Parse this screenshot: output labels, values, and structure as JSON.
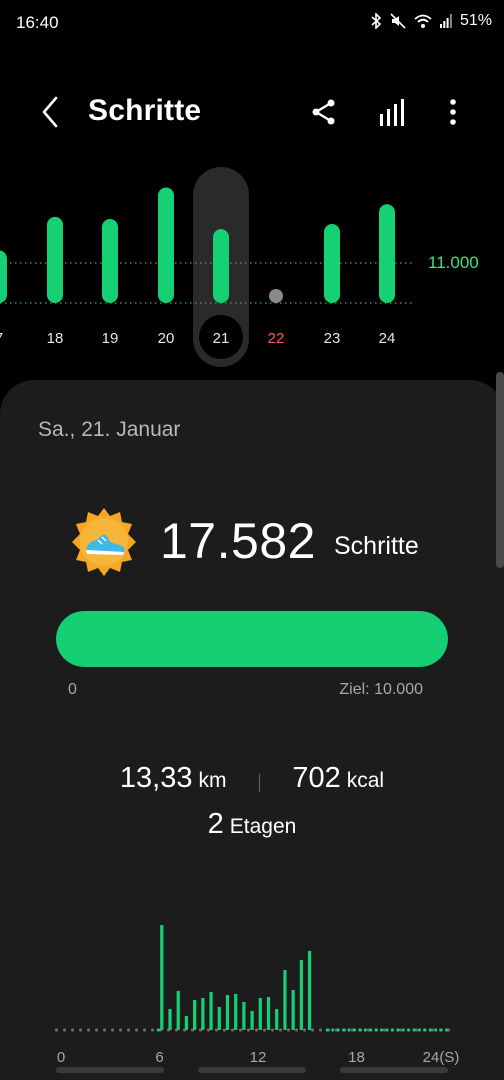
{
  "status_bar": {
    "time": "16:40",
    "battery": "51%",
    "icons": [
      "bluetooth-icon",
      "mute-icon",
      "wifi-icon",
      "signal-icon"
    ]
  },
  "header": {
    "title": "Schritte",
    "back_icon": "chevron-left-icon",
    "actions": [
      "share-icon",
      "bar-chart-icon",
      "more-vertical-icon"
    ]
  },
  "week_chart": {
    "target_label": "11.000",
    "selected_day": "21",
    "today_day": "22",
    "days": [
      {
        "label": "7",
        "steps": 12500
      },
      {
        "label": "18",
        "steps": 20500
      },
      {
        "label": "19",
        "steps": 20000
      },
      {
        "label": "20",
        "steps": 27500
      },
      {
        "label": "21",
        "steps": 17582
      },
      {
        "label": "22",
        "steps": 0
      },
      {
        "label": "23",
        "steps": 18800
      },
      {
        "label": "24",
        "steps": 23500
      }
    ],
    "colors": {
      "bar": "#16d173",
      "today_label": "#ff5a5a",
      "target_line": "#2bb466"
    }
  },
  "summary": {
    "date": "Sa., 21. Januar",
    "steps": "17.582",
    "steps_unit": "Schritte",
    "progress_fraction": 1.0,
    "progress_min": "0",
    "progress_goal": "Ziel: 10.000",
    "distance": "13,33",
    "distance_unit": "km",
    "calories": "702",
    "calories_unit": "kcal",
    "floors": "2",
    "floors_unit": "Etagen",
    "badge_icon": "running-shoe-badge-icon"
  },
  "day_chart": {
    "x_labels": [
      "0",
      "6",
      "12",
      "18",
      "24(S)"
    ],
    "hourly_slots": [
      {
        "hour": 6.5,
        "steps": 1050
      },
      {
        "hour": 7.0,
        "steps": 210
      },
      {
        "hour": 7.5,
        "steps": 390
      },
      {
        "hour": 8.0,
        "steps": 140
      },
      {
        "hour": 8.5,
        "steps": 300
      },
      {
        "hour": 9.0,
        "steps": 320
      },
      {
        "hour": 9.5,
        "steps": 380
      },
      {
        "hour": 10.0,
        "steps": 230
      },
      {
        "hour": 10.5,
        "steps": 350
      },
      {
        "hour": 11.0,
        "steps": 360
      },
      {
        "hour": 11.5,
        "steps": 280
      },
      {
        "hour": 12.0,
        "steps": 190
      },
      {
        "hour": 12.5,
        "steps": 320
      },
      {
        "hour": 13.0,
        "steps": 330
      },
      {
        "hour": 13.5,
        "steps": 210
      },
      {
        "hour": 14.0,
        "steps": 600
      },
      {
        "hour": 14.5,
        "steps": 400
      },
      {
        "hour": 15.0,
        "steps": 700
      },
      {
        "hour": 15.5,
        "steps": 790
      }
    ],
    "color": "#16d173"
  }
}
